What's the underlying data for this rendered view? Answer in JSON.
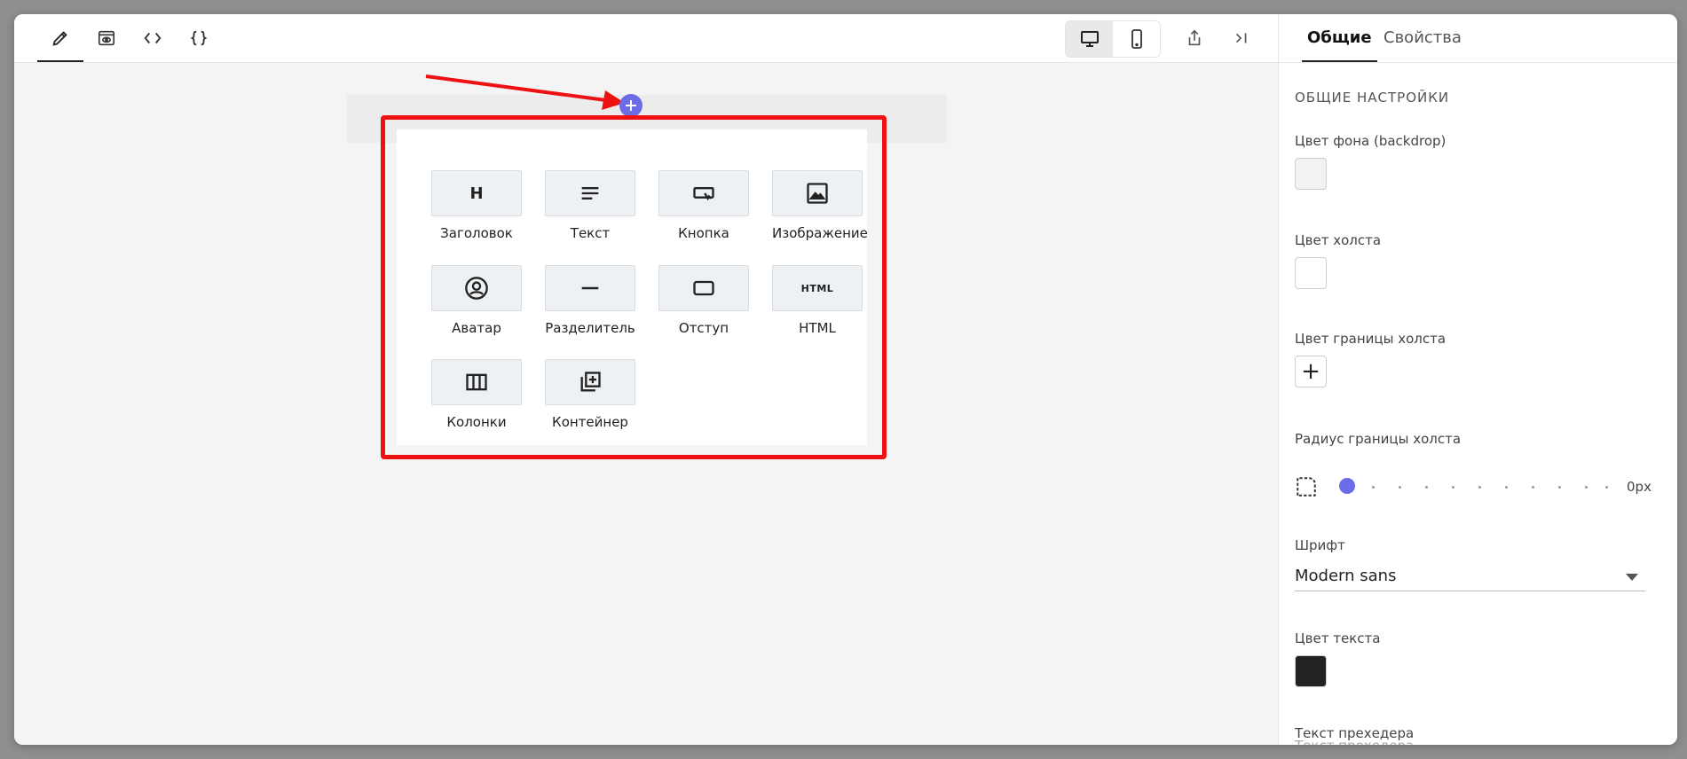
{
  "toolbar": {
    "edit": "edit-icon",
    "preview": "eye-icon",
    "code": "code-icon",
    "json": "braces-icon",
    "desktop": "desktop-icon",
    "mobile": "mobile-icon",
    "export": "share-icon",
    "collapse": "collapse-panel-icon"
  },
  "blocks": [
    {
      "label": "Заголовок",
      "icon": "heading-icon"
    },
    {
      "label": "Текст",
      "icon": "text-icon"
    },
    {
      "label": "Кнопка",
      "icon": "button-icon"
    },
    {
      "label": "Изображение",
      "icon": "image-icon"
    },
    {
      "label": "Аватар",
      "icon": "avatar-icon"
    },
    {
      "label": "Разделитель",
      "icon": "divider-icon"
    },
    {
      "label": "Отступ",
      "icon": "spacer-icon"
    },
    {
      "label": "HTML",
      "icon": "html-icon"
    },
    {
      "label": "Колонки",
      "icon": "columns-icon"
    },
    {
      "label": "Контейнер",
      "icon": "container-icon"
    }
  ],
  "sidebar": {
    "tabs": [
      "Общие",
      "Свойства"
    ],
    "section_title": "ОБЩИЕ НАСТРОЙКИ",
    "backdrop_label": "Цвет фона (backdrop)",
    "backdrop_color": "#f2f2f2",
    "canvas_label": "Цвет холста",
    "canvas_color": "#ffffff",
    "border_label": "Цвет границы холста",
    "radius_label": "Радиус границы холста",
    "radius_value": "0px",
    "font_label": "Шрифт",
    "font_value": "Modern sans",
    "text_color_label": "Цвет текста",
    "text_color": "#222222",
    "preheader_label": "Текст прехедера",
    "preheader_placeholder": "Текст прехедера"
  },
  "colors": {
    "accent": "#6d6ce8",
    "highlight": "#ee1111"
  }
}
